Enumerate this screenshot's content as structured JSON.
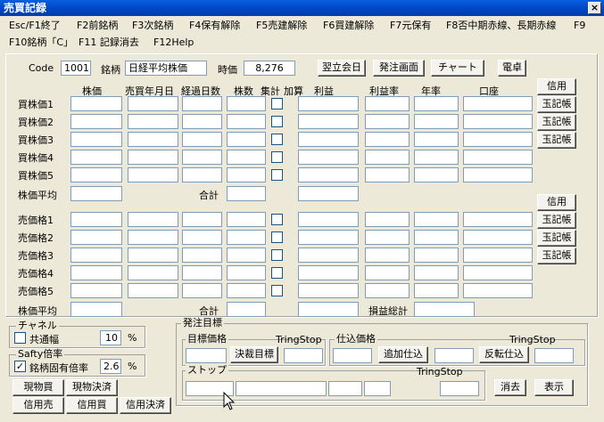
{
  "window": {
    "title": "売買記録",
    "close_label": "×"
  },
  "menu": {
    "row1": [
      "Esc/F1終了",
      "F2前銘柄",
      "F3次銘柄",
      "F4保有解除",
      "F5売建解除",
      "F6買建解除",
      "F7元保有",
      "F8否中期赤線、長期赤線",
      "F9"
    ],
    "row2": [
      "F10銘柄「C」",
      "F11 記録消去",
      "F12Help"
    ]
  },
  "header": {
    "code_label": "Code",
    "code_value": "1001",
    "name_label": "銘柄",
    "name_value": "日経平均株価",
    "price_label": "時価",
    "price_value": "8,276",
    "btn_next_day": "翌立会日",
    "btn_order": "発注画面",
    "btn_chart": "チャート",
    "btn_calc": "電卓"
  },
  "columns": {
    "price": "株価",
    "date": "売買年月日",
    "days": "経過日数",
    "shares": "株数",
    "sum": "集計",
    "add": "加算",
    "profit": "利益",
    "rate": "利益率",
    "annual": "年率",
    "account": "口座"
  },
  "buy": {
    "rows": [
      "買株価1",
      "買株価2",
      "買株価3",
      "買株価4",
      "買株価5"
    ],
    "avg_label": "株価平均",
    "total_label": "合計",
    "credit_btn": "信用",
    "ledger_btns": [
      "玉記帳",
      "玉記帳",
      "玉記帳"
    ]
  },
  "sell": {
    "rows": [
      "売価格1",
      "売価格2",
      "売価格3",
      "売価格4",
      "売価格5"
    ],
    "avg_label": "株価平均",
    "total_label": "合計",
    "pl_total_label": "損益総計",
    "credit_btn": "信用",
    "ledger_btns": [
      "玉記帳",
      "玉記帳",
      "玉記帳"
    ]
  },
  "channel": {
    "title": "チャネル",
    "check_label": "共通幅",
    "value": "10",
    "unit": "%"
  },
  "safety": {
    "title": "Safty倍率",
    "check_mark": "✓",
    "check_label": "銘柄固有倍率",
    "value": "2.6",
    "unit": "%"
  },
  "trade_btns": {
    "spot_buy": "現物買",
    "spot_settle": "現物決済",
    "credit_sell": "信用売",
    "credit_buy": "信用買",
    "credit_settle": "信用決済"
  },
  "order": {
    "title": "発注目標",
    "target_label": "目標価格",
    "tring1": "TringStop",
    "target_btn": "決裁目標",
    "buy_label": "仕込価格",
    "tring2": "TringStop",
    "add_btn": "追加仕込",
    "reverse_btn": "反転仕込",
    "stop_label": "ストップ",
    "tring3": "TringStop",
    "clear_btn": "消去",
    "show_btn": "表示"
  }
}
